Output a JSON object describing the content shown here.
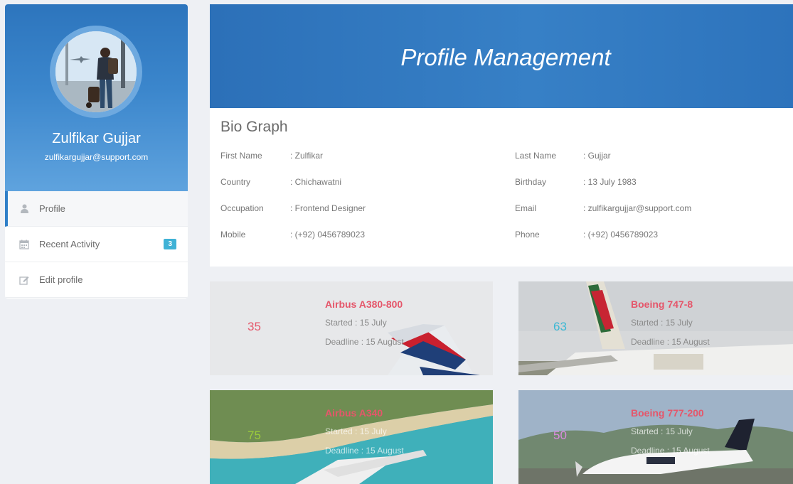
{
  "profile": {
    "name": "Zulfikar Gujjar",
    "email": "zulfikargujjar@support.com"
  },
  "menu": [
    {
      "label": "Profile",
      "icon": "user-icon",
      "active": true
    },
    {
      "label": "Recent Activity",
      "icon": "calendar-icon",
      "badge": "3"
    },
    {
      "label": "Edit profile",
      "icon": "edit-icon"
    }
  ],
  "banner": {
    "title": "Profile Management"
  },
  "bio": {
    "title": "Bio Graph",
    "fields": [
      {
        "label": "First Name",
        "value": ": Zulfikar"
      },
      {
        "label": "Last Name",
        "value": ": Gujjar"
      },
      {
        "label": "Country",
        "value": ": Chichawatni"
      },
      {
        "label": "Birthday",
        "value": ": 13 July 1983"
      },
      {
        "label": "Occupation",
        "value": ": Frontend Designer"
      },
      {
        "label": "Email",
        "value": ": zulfikargujjar@support.com"
      },
      {
        "label": "Mobile",
        "value": ": (+92) 0456789023"
      },
      {
        "label": "Phone",
        "value": ": (+92) 0456789023"
      }
    ]
  },
  "projects": [
    {
      "number": "35",
      "title": "Airbus A380-800",
      "started": "Started : 15 July",
      "deadline": "Deadline : 15 August",
      "color": "#e5566a"
    },
    {
      "number": "63",
      "title": "Boeing 747-8",
      "started": "Started : 15 July",
      "deadline": "Deadline : 15 August",
      "color": "#3bb8d4"
    },
    {
      "number": "75",
      "title": "Airbus A340",
      "started": "Started : 15 July",
      "deadline": "Deadline : 15 August",
      "color": "#9ccc3a"
    },
    {
      "number": "50",
      "title": "Boeing 777-200",
      "started": "Started : 15 July",
      "deadline": "Deadline : 15 August",
      "color": "#d98be0"
    }
  ]
}
